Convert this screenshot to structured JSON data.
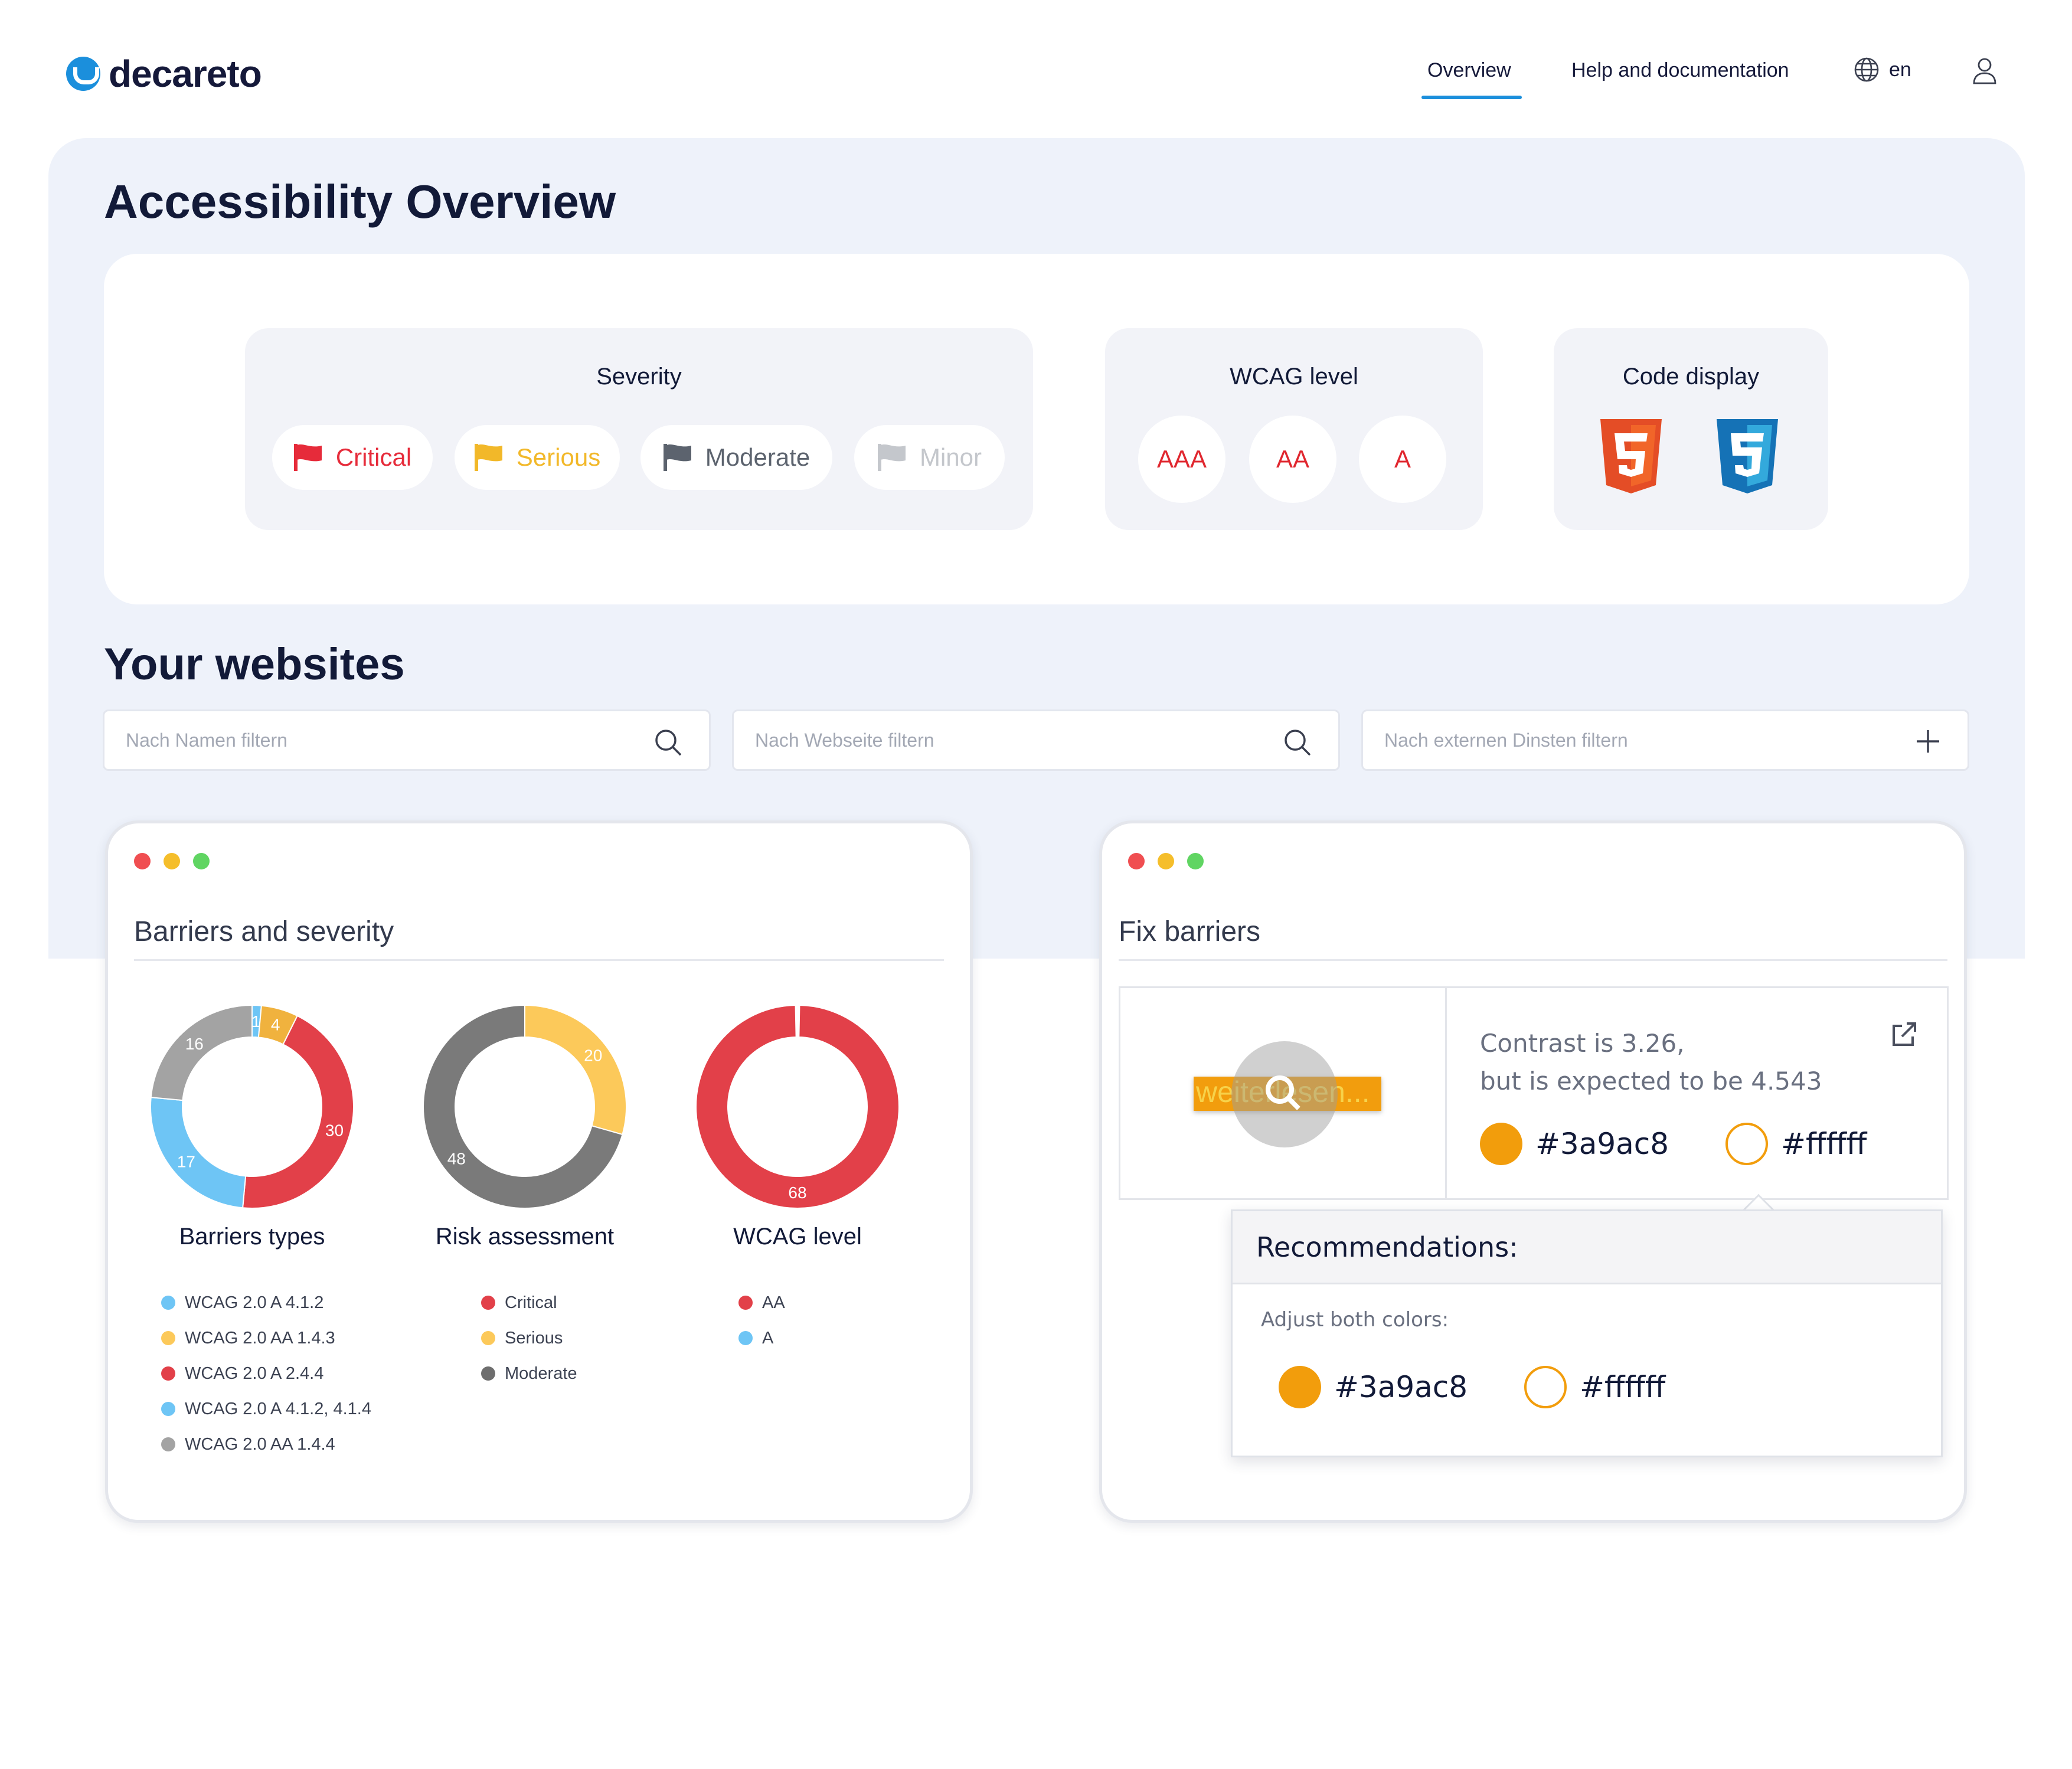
{
  "header": {
    "brand": "decareto",
    "nav": {
      "overview": "Overview",
      "help": "Help and documentation",
      "language": "en"
    }
  },
  "page": {
    "title": "Accessibility Overview",
    "websites_title": "Your websites"
  },
  "filters": {
    "severity": {
      "title": "Severity",
      "critical": "Critical",
      "serious": "Serious",
      "moderate": "Moderate",
      "minor": "Minor"
    },
    "wcag": {
      "title": "WCAG level",
      "aaa": "AAA",
      "aa": "AA",
      "a": "A"
    },
    "code": {
      "title": "Code display",
      "icons": [
        "html5-icon",
        "css3-icon"
      ]
    }
  },
  "search": {
    "name_placeholder": "Nach Namen filtern",
    "website_placeholder": "Nach Webseite filtern",
    "external_placeholder": "Nach externen Dinsten filtern"
  },
  "colors": {
    "critical": "#e62b3a",
    "serious": "#f2b829",
    "moderate": "#5c636e",
    "minor": "#c4c7cc",
    "accent": "#1b8fdc",
    "blue": "#6ec5f5",
    "yellow": "#fcc95a",
    "red": "#e24049",
    "grey": "#9a9a9a",
    "dark": "#5a5a5a"
  },
  "barriers_panel": {
    "title": "Barriers and severity",
    "charts": [
      {
        "label": "Barriers types",
        "segments": [
          {
            "value": 1,
            "color": "#6ec5f5"
          },
          {
            "value": 4,
            "color": "#f0b23e"
          },
          {
            "value": 30,
            "color": "#e24049"
          },
          {
            "value": 17,
            "color": "#6ec5f5"
          },
          {
            "value": 16,
            "color": "#a3a3a3"
          }
        ],
        "legend": [
          {
            "label": "WCAG 2.0 A 4.1.2",
            "color": "#6ec5f5"
          },
          {
            "label": "WCAG 2.0 AA 1.4.3",
            "color": "#fcc95a"
          },
          {
            "label": "WCAG 2.0 A 2.4.4",
            "color": "#e24049"
          },
          {
            "label": "WCAG 2.0 A 4.1.2, 4.1.4",
            "color": "#6ec5f5"
          },
          {
            "label": "WCAG 2.0 AA 1.4.4",
            "color": "#a3a3a3"
          }
        ]
      },
      {
        "label": "Risk assessment",
        "segments": [
          {
            "value": 20,
            "color": "#fcc95a"
          },
          {
            "value": 48,
            "color": "#7a7a7a"
          }
        ],
        "legend": [
          {
            "label": "Critical",
            "color": "#e24049"
          },
          {
            "label": "Serious",
            "color": "#fcc95a"
          },
          {
            "label": "Moderate",
            "color": "#6e6e6e"
          }
        ]
      },
      {
        "label": "WCAG level",
        "segments": [
          {
            "value": 68,
            "color": "#e24049"
          }
        ],
        "legend": [
          {
            "label": "AA",
            "color": "#e24049"
          },
          {
            "label": "A",
            "color": "#6ec5f5"
          }
        ]
      }
    ]
  },
  "fix_panel": {
    "title": "Fix barriers",
    "preview_text": "weiterlesen...",
    "contrast_line1": "Contrast is 3.26,",
    "contrast_line2": "but is expected to be 4.543",
    "color1": "#3a9ac8",
    "color2": "#ffffff",
    "recommendations": {
      "title": "Recommendations:",
      "subtitle": "Adjust both colors:",
      "color1": "#3a9ac8",
      "color2": "#ffffff"
    }
  }
}
